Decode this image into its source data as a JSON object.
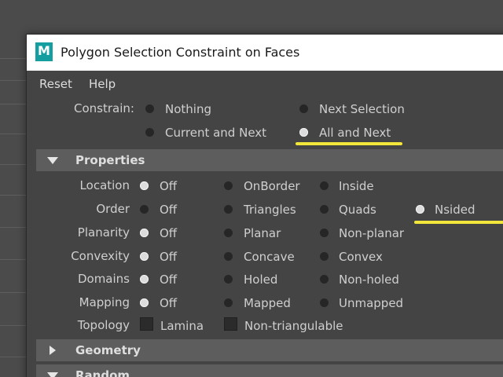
{
  "window": {
    "title": "Polygon Selection Constraint on Faces",
    "app_icon_letter": "M"
  },
  "menubar": {
    "items": [
      "Reset",
      "Help"
    ]
  },
  "constrain": {
    "label": "Constrain:",
    "options": [
      "Nothing",
      "Next Selection",
      "Current and Next",
      "All and Next"
    ],
    "selected": "All and Next"
  },
  "properties": {
    "title": "Properties",
    "expanded": true,
    "rows": {
      "location": {
        "label": "Location",
        "options": [
          "Off",
          "OnBorder",
          "Inside"
        ],
        "selected": "Off"
      },
      "order": {
        "label": "Order",
        "options": [
          "Off",
          "Triangles",
          "Quads",
          "Nsided"
        ],
        "selected": "Nsided"
      },
      "planarity": {
        "label": "Planarity",
        "options": [
          "Off",
          "Planar",
          "Non-planar"
        ],
        "selected": "Off"
      },
      "convexity": {
        "label": "Convexity",
        "options": [
          "Off",
          "Concave",
          "Convex"
        ],
        "selected": "Off"
      },
      "domains": {
        "label": "Domains",
        "options": [
          "Off",
          "Holed",
          "Non-holed"
        ],
        "selected": "Off"
      },
      "mapping": {
        "label": "Mapping",
        "options": [
          "Off",
          "Mapped",
          "Unmapped"
        ],
        "selected": "Off"
      },
      "topology": {
        "label": "Topology",
        "checkboxes": [
          {
            "label": "Lamina",
            "checked": false
          },
          {
            "label": "Non-triangulable",
            "checked": false
          }
        ]
      }
    }
  },
  "geometry": {
    "title": "Geometry",
    "expanded": false
  },
  "random": {
    "title": "Random",
    "expanded": true
  },
  "colors": {
    "highlight": "#f3e63a",
    "panel": "#444444",
    "section_header": "#5d5d5d",
    "icon": "#149ea0"
  }
}
